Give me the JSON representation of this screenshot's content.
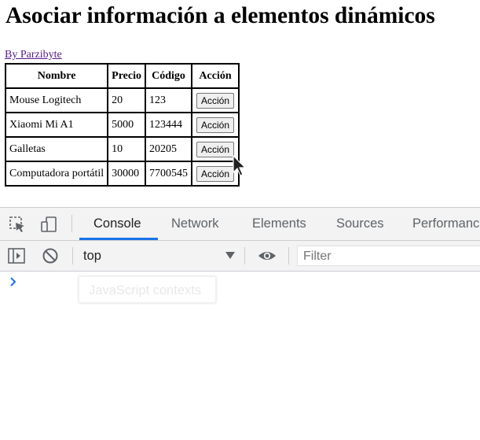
{
  "page": {
    "title": "Asociar información a elementos dinámicos",
    "author_link": "By Parzibyte"
  },
  "table": {
    "headers": [
      "Nombre",
      "Precio",
      "Código",
      "Acción"
    ],
    "rows": [
      {
        "nombre": "Mouse Logitech",
        "precio": "20",
        "codigo": "123",
        "accion": "Acción"
      },
      {
        "nombre": "Xiaomi Mi A1",
        "precio": "5000",
        "codigo": "123444",
        "accion": "Acción"
      },
      {
        "nombre": "Galletas",
        "precio": "10",
        "codigo": "20205",
        "accion": "Acción"
      },
      {
        "nombre": "Computadora portátil",
        "precio": "30000",
        "codigo": "7700545",
        "accion": "Acción"
      }
    ]
  },
  "devtools": {
    "tabs": [
      "Console",
      "Network",
      "Elements",
      "Sources",
      "Performance"
    ],
    "active_tab": "Console",
    "context_select": "top",
    "filter_placeholder": "Filter",
    "tooltip": "JavaScript contexts",
    "accent_color": "#1a73e8"
  }
}
